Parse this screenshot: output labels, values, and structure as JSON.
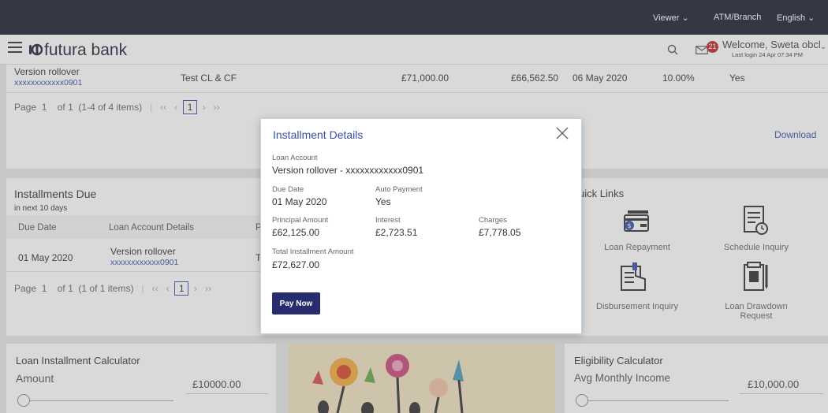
{
  "topbar": {
    "role": "Viewer",
    "atm": "ATM/Branch",
    "language": "English"
  },
  "header": {
    "brand": "futura bank",
    "notifications": "21",
    "welcome": "Welcome, Sweta obcl",
    "last_login": "Last login 24 Apr 07:34 PM"
  },
  "loans_table": {
    "row": {
      "name": "Version rollover",
      "account": "xxxxxxxxxxxx0901",
      "product": "Test CL & CF",
      "amount": "£71,000.00",
      "outstanding": "£66,562.50",
      "date": "06 May 2020",
      "rate": "10.00%",
      "flag": "Yes"
    },
    "pager": {
      "page_label": "Page",
      "page": "1",
      "of": "of 1",
      "items": "(1-4 of 4 items)",
      "current": "1"
    },
    "download": "Download"
  },
  "installments": {
    "title": "Installments Due",
    "subtitle": "in next 10 days",
    "col_due": "Due Date",
    "col_account": "Loan Account Details",
    "col_p": "P",
    "row": {
      "due": "01 May 2020",
      "name": "Version rollover",
      "account": "xxxxxxxxxxxx0901",
      "t": "T"
    },
    "pager": {
      "page_label": "Page",
      "page": "1",
      "of": "of 1",
      "items": "(1 of 1 items)",
      "current": "1"
    }
  },
  "quick_links": {
    "title": "uick Links",
    "items": [
      {
        "label": "Loan Repayment"
      },
      {
        "label": "Schedule Inquiry"
      },
      {
        "label": "Disbursement Inquiry"
      },
      {
        "label": "Loan Drawdown Request"
      }
    ]
  },
  "calculator": {
    "title": "Loan Installment Calculator",
    "amount_label": "Amount",
    "amount_value": "£10000.00"
  },
  "eligibility": {
    "title": "Eligibility Calculator",
    "income_label": "Avg Monthly Income",
    "income_value": "£10,000.00"
  },
  "modal": {
    "title": "Installment Details",
    "loan_account_label": "Loan Account",
    "loan_account_value": "Version rollover - xxxxxxxxxxxx0901",
    "due_date_label": "Due Date",
    "due_date_value": "01 May 2020",
    "auto_payment_label": "Auto Payment",
    "auto_payment_value": "Yes",
    "principal_label": "Principal Amount",
    "principal_value": "£62,125.00",
    "interest_label": "Interest",
    "interest_value": "£2,723.51",
    "charges_label": "Charges",
    "charges_value": "£7,778.05",
    "total_label": "Total Installment Amount",
    "total_value": "£72,627.00",
    "pay_now": "Pay Now"
  },
  "colors": {
    "topbar": "#1e1f33",
    "brand_blue": "#3a4fa3",
    "button": "#262c6e",
    "badge": "#c0262d"
  }
}
